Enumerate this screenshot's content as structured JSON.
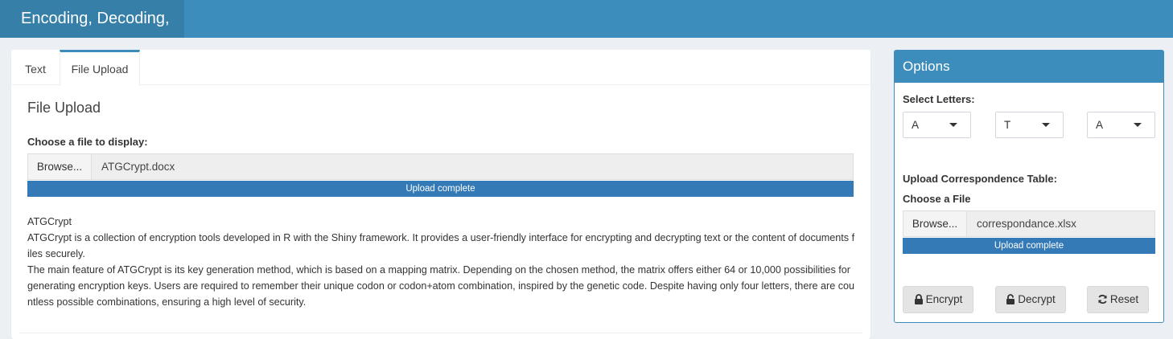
{
  "header": {
    "title": "Encoding, Decoding,"
  },
  "tabs": [
    {
      "label": "Text"
    },
    {
      "label": "File Upload"
    }
  ],
  "main": {
    "heading": "File Upload",
    "file_label": "Choose a file to display:",
    "browse_label": "Browse...",
    "file_name": "ATGCrypt.docx",
    "progress_text": "Upload complete",
    "progress_fraction": 1.0,
    "desc_title": "ATGCrypt",
    "desc_para1": "ATGCrypt is a collection of encryption tools developed in R with the Shiny framework. It provides a user-friendly interface for encrypting and decrypting text or the content of documents files securely.",
    "desc_para2": "The main feature of ATGCrypt is its key generation method, which is based on a mapping matrix. Depending on the chosen method, the matrix offers either 64 or 10,000 possibilities for generating encryption keys. Users are required to remember their unique codon or codon+atom combination, inspired by the genetic code. Despite having only four letters, there are countless possible combinations, ensuring a high level of security."
  },
  "options": {
    "title": "Options",
    "select_letters_label": "Select Letters:",
    "letters": [
      "A",
      "T",
      "A"
    ],
    "upload_table_label": "Upload Correspondence Table:",
    "choose_file_label": "Choose a File",
    "browse_label": "Browse...",
    "file_name": "correspondance.xlsx",
    "progress_text": "Upload complete",
    "progress_fraction": 1.0,
    "buttons": {
      "encrypt": "Encrypt",
      "decrypt": "Decrypt",
      "reset": "Reset"
    }
  },
  "colors": {
    "header": "#3c8dbc",
    "brand": "#367fa9",
    "progress": "#337ab7"
  },
  "icons": {
    "encrypt": "lock-icon",
    "decrypt": "unlock-icon",
    "reset": "refresh-icon",
    "dropdown": "caret-down-icon"
  }
}
